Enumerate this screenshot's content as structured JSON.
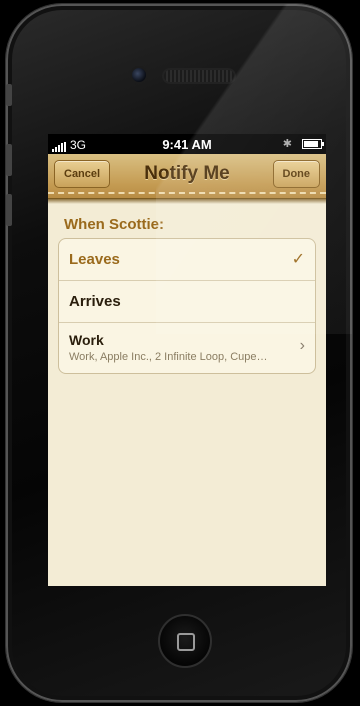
{
  "status_bar": {
    "carrier": "3G",
    "time": "9:41 AM"
  },
  "nav": {
    "cancel_label": "Cancel",
    "title": "Notify Me",
    "done_label": "Done"
  },
  "section": {
    "header": "When Scottie:"
  },
  "options": [
    {
      "label": "Leaves",
      "selected": true
    },
    {
      "label": "Arrives",
      "selected": false
    },
    {
      "label": "Work",
      "subtitle": "Work, Apple Inc., 2 Infinite Loop, Cupe…",
      "selected": false
    }
  ],
  "colors": {
    "accent": "#9a6a1c",
    "paper": "#f3ecd5",
    "leather": "#c49b52"
  },
  "icons": {
    "check": "checkmark-icon",
    "chevron": "chevron-right-icon",
    "bluetooth": "bluetooth-icon",
    "battery": "battery-icon"
  }
}
